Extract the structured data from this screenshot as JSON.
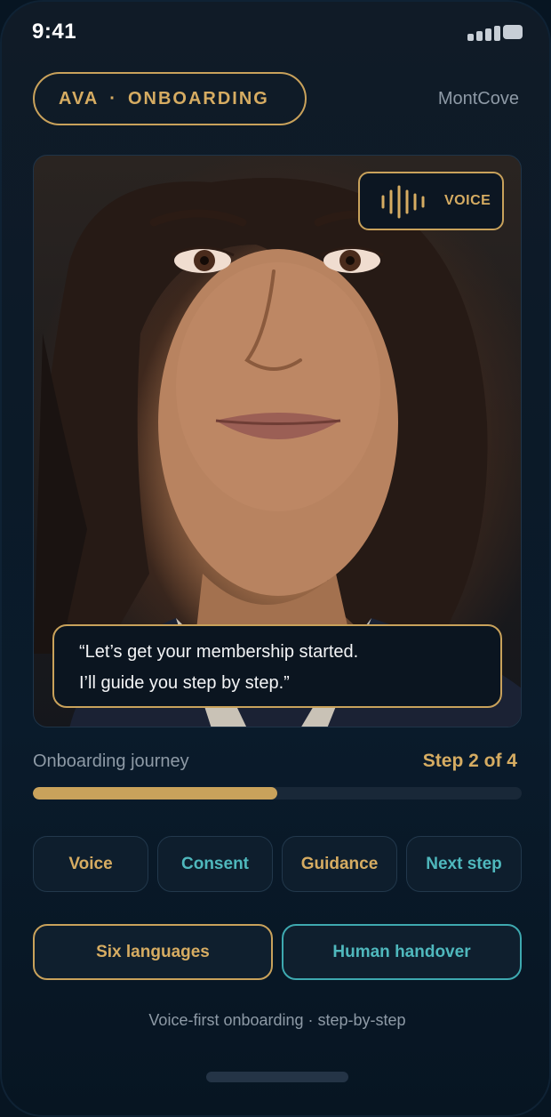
{
  "status": {
    "time": "9:41"
  },
  "header": {
    "assistant_name": "AVA",
    "separator": "·",
    "section": "ONBOARDING",
    "brand": "MontCove"
  },
  "hero": {
    "badge": {
      "icon": "voice-wave-icon",
      "label": "VOICE"
    },
    "caption_lines": [
      "“Let’s get your membership started.",
      "I’ll guide you step by step.”"
    ]
  },
  "journey": {
    "label": "Onboarding journey",
    "step_text": "Step 2 of 4",
    "progress": 0.5
  },
  "chips": [
    {
      "label": "Voice",
      "color": "#d6ac62"
    },
    {
      "label": "Consent",
      "color": "#4fb8bd"
    },
    {
      "label": "Guidance",
      "color": "#d6ac62"
    },
    {
      "label": "Next step",
      "color": "#4fb8bd"
    }
  ],
  "actions": {
    "languages": "Six languages",
    "handover": "Human handover"
  },
  "footer": "Voice-first onboarding · step-by-step",
  "colors": {
    "accent_gold": "#c9a25b",
    "accent_teal": "#3ea9b0",
    "background": "#0a1b2b"
  }
}
